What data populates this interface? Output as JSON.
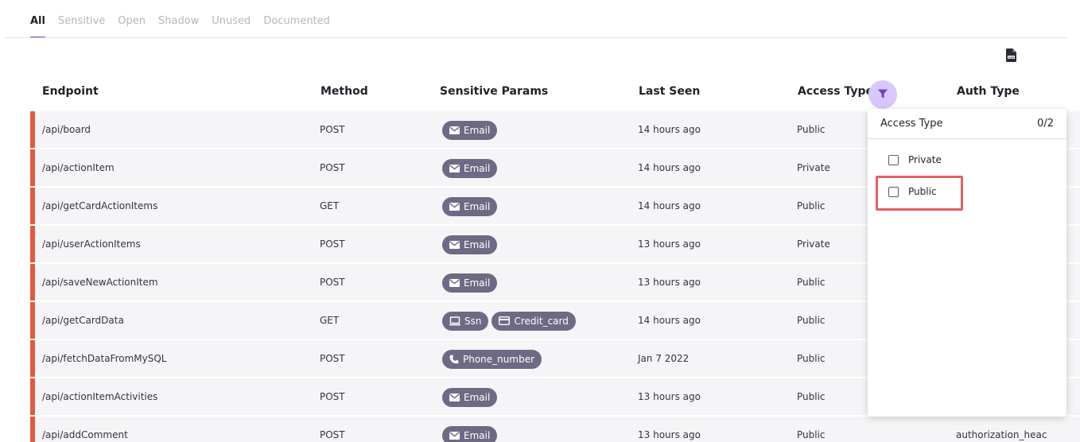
{
  "tabs": [
    {
      "label": "All",
      "active": true
    },
    {
      "label": "Sensitive",
      "active": false
    },
    {
      "label": "Open",
      "active": false
    },
    {
      "label": "Shadow",
      "active": false
    },
    {
      "label": "Unused",
      "active": false
    },
    {
      "label": "Documented",
      "active": false
    }
  ],
  "toolbar": {
    "csv_icon": "csv-file-icon"
  },
  "table": {
    "columns": [
      "Endpoint",
      "Method",
      "Sensitive Params",
      "Last Seen",
      "Access Type",
      "Auth Type"
    ],
    "rows": [
      {
        "endpoint": "/api/board",
        "method": "POST",
        "params": [
          {
            "icon": "email-icon",
            "label": "Email"
          }
        ],
        "last_seen": "14 hours ago",
        "access": "Public",
        "auth": ""
      },
      {
        "endpoint": "/api/actionItem",
        "method": "POST",
        "params": [
          {
            "icon": "email-icon",
            "label": "Email"
          }
        ],
        "last_seen": "14 hours ago",
        "access": "Private",
        "auth": ""
      },
      {
        "endpoint": "/api/getCardActionItems",
        "method": "GET",
        "params": [
          {
            "icon": "email-icon",
            "label": "Email"
          }
        ],
        "last_seen": "14 hours ago",
        "access": "Public",
        "auth": ""
      },
      {
        "endpoint": "/api/userActionItems",
        "method": "POST",
        "params": [
          {
            "icon": "email-icon",
            "label": "Email"
          }
        ],
        "last_seen": "13 hours ago",
        "access": "Private",
        "auth": ""
      },
      {
        "endpoint": "/api/saveNewActionItem",
        "method": "POST",
        "params": [
          {
            "icon": "email-icon",
            "label": "Email"
          }
        ],
        "last_seen": "13 hours ago",
        "access": "Public",
        "auth": ""
      },
      {
        "endpoint": "/api/getCardData",
        "method": "GET",
        "params": [
          {
            "icon": "monitor-icon",
            "label": "Ssn"
          },
          {
            "icon": "credit-card-icon",
            "label": "Credit_card"
          }
        ],
        "last_seen": "14 hours ago",
        "access": "Public",
        "auth": ""
      },
      {
        "endpoint": "/api/fetchDataFromMySQL",
        "method": "POST",
        "params": [
          {
            "icon": "phone-icon",
            "label": "Phone_number"
          }
        ],
        "last_seen": "Jan 7 2022",
        "access": "Public",
        "auth": ""
      },
      {
        "endpoint": "/api/actionItemActivities",
        "method": "POST",
        "params": [
          {
            "icon": "email-icon",
            "label": "Email"
          }
        ],
        "last_seen": "13 hours ago",
        "access": "Public",
        "auth": ""
      },
      {
        "endpoint": "/api/addComment",
        "method": "POST",
        "params": [
          {
            "icon": "email-icon",
            "label": "Email"
          }
        ],
        "last_seen": "13 hours ago",
        "access": "Public",
        "auth": "authorization_heac"
      }
    ]
  },
  "filter": {
    "title": "Access Type",
    "count": "0/2",
    "options": [
      "Private",
      "Public"
    ],
    "accent": "#d9c8ff",
    "icon": "filter-funnel-icon"
  },
  "colors": {
    "row_marker": "#e05a3c",
    "chip_bg": "#6e6a84",
    "tab_accent": "#6f42c1",
    "highlight": "#e26262"
  }
}
